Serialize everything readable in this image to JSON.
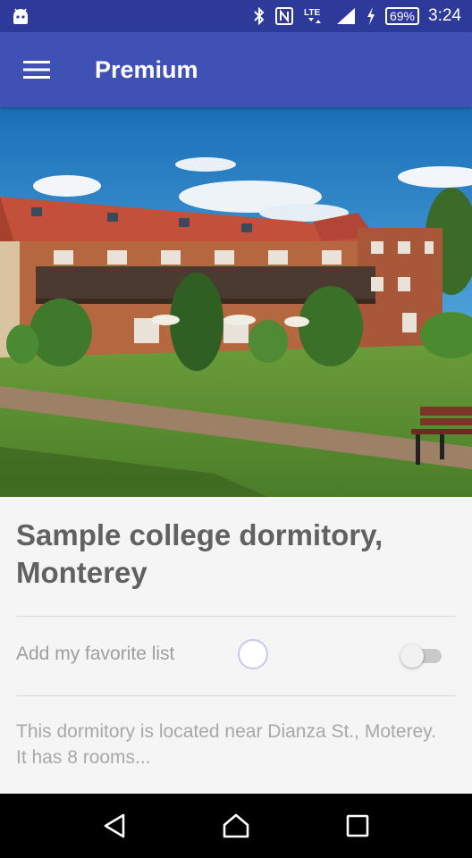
{
  "status_bar": {
    "battery": "69%",
    "time": "3:24",
    "network": "LTE",
    "icons": [
      "android-icon",
      "bluetooth-icon",
      "nfc-icon",
      "lte-icon",
      "signal-icon",
      "charging-icon",
      "battery-icon"
    ]
  },
  "app_bar": {
    "title": "Premium",
    "menu_icon": "hamburger-menu-icon",
    "color": "#3f51b5",
    "status_color": "#2e3a9a"
  },
  "hero": {
    "image": "dormitory-photo"
  },
  "listing": {
    "title": "Sample college dormitory, Monterey",
    "favorite_label": "Add my favorite list",
    "favorite_on": false,
    "description": "This dormitory is located near Dianza St., Moterey. It has 8 rooms..."
  },
  "nav_bar": {
    "icons": [
      "back-icon",
      "home-icon",
      "recents-icon"
    ]
  }
}
